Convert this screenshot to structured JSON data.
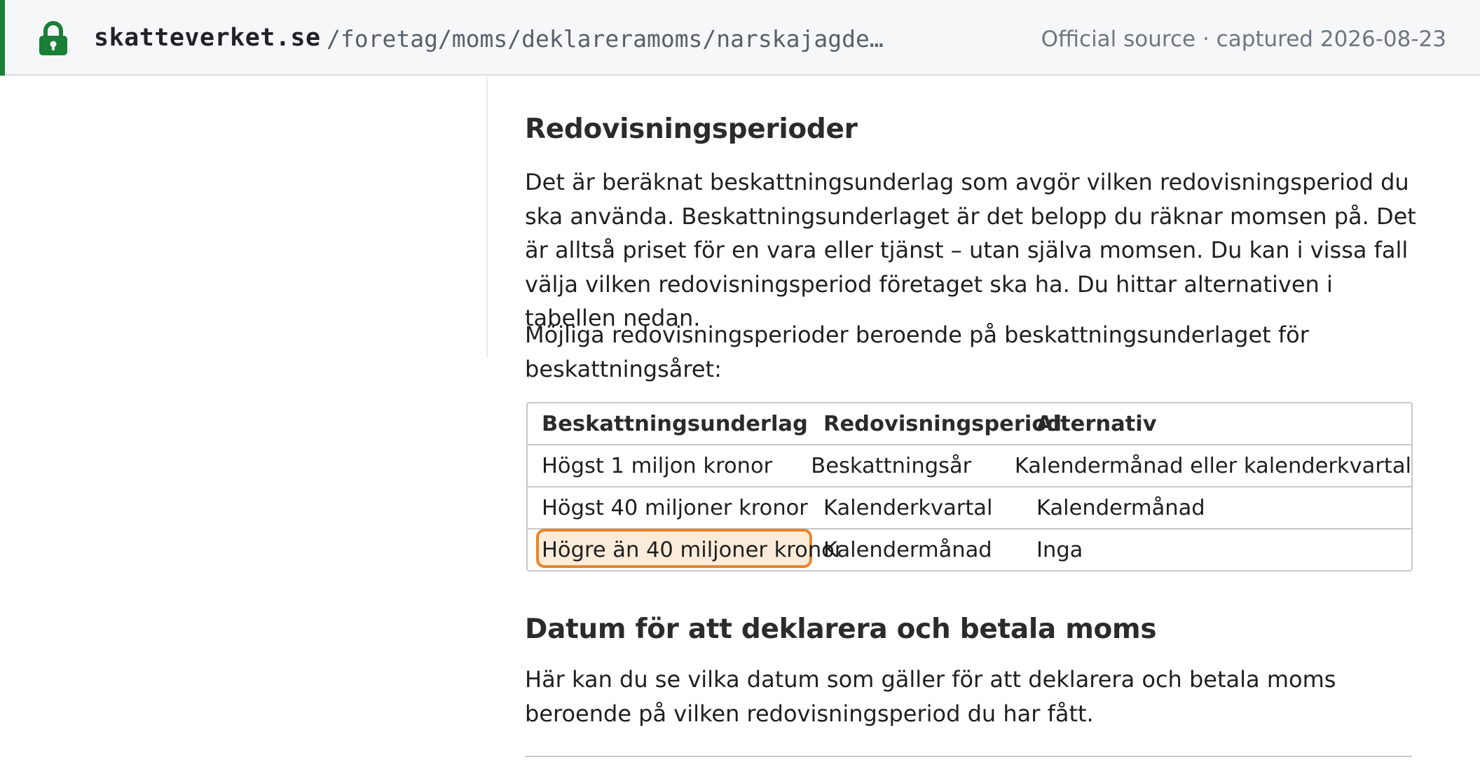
{
  "address_bar": {
    "domain": "skatteverket.se",
    "path": "/foretag/moms/deklareramoms/narskajagde…",
    "captured": "Official source · captured 2026-08-23",
    "lock_icon": "lock-icon",
    "accent_color": "#1a7f37"
  },
  "article": {
    "section1": {
      "heading": "Redovisningsperioder",
      "paragraph": "Det är beräknat beskattningsunderlag som avgör vilken redovisningsperiod du ska använda. Beskattningsunderlaget är det belopp du räknar momsen på. Det är alltså priset för en vara eller tjänst – utan själva momsen. Du kan i vissa fall välja vilken redovisningsperiod företaget ska ha. Du hittar alternativen i tabellen nedan.",
      "intro": "Möjliga redovisningsperioder beroende på beskattningsunderlaget för beskattningsåret:"
    },
    "table": {
      "headers": [
        "Beskattningsunderlag",
        "Redovisningsperiod",
        "Alternativ"
      ],
      "rows": [
        [
          "Högst 1 miljon kronor",
          "Beskattningsår",
          "Kalendermånad eller kalenderkvartal"
        ],
        [
          "Högst 40 miljoner kronor",
          "Kalenderkvartal",
          "Kalendermånad"
        ],
        [
          "Högre än 40 miljoner kronor",
          "Kalendermånad",
          "Inga"
        ]
      ],
      "highlight_color": "#e8852f"
    },
    "section2": {
      "heading": "Datum för att deklarera och betala moms",
      "paragraph": "Här kan du se vilka datum som gäller för att deklarera och betala moms beroende på vilken redovisningsperiod du har fått."
    }
  }
}
